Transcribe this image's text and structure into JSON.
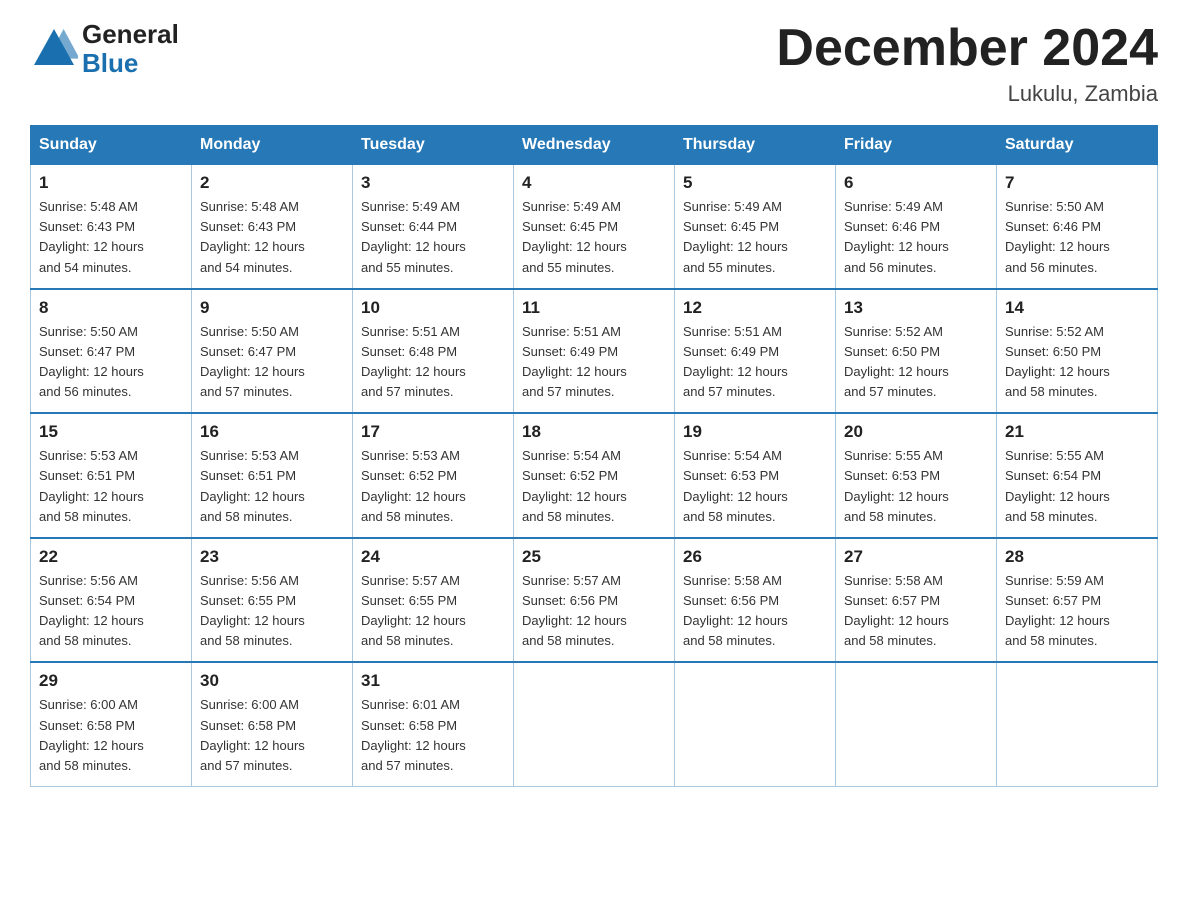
{
  "header": {
    "logo": {
      "general": "General",
      "blue": "Blue",
      "triangle_color": "#1a6faf"
    },
    "title": "December 2024",
    "location": "Lukulu, Zambia"
  },
  "calendar": {
    "days_of_week": [
      "Sunday",
      "Monday",
      "Tuesday",
      "Wednesday",
      "Thursday",
      "Friday",
      "Saturday"
    ],
    "accent_color": "#2678b6",
    "weeks": [
      [
        {
          "day": "1",
          "sunrise": "5:48 AM",
          "sunset": "6:43 PM",
          "daylight": "12 hours and 54 minutes."
        },
        {
          "day": "2",
          "sunrise": "5:48 AM",
          "sunset": "6:43 PM",
          "daylight": "12 hours and 54 minutes."
        },
        {
          "day": "3",
          "sunrise": "5:49 AM",
          "sunset": "6:44 PM",
          "daylight": "12 hours and 55 minutes."
        },
        {
          "day": "4",
          "sunrise": "5:49 AM",
          "sunset": "6:45 PM",
          "daylight": "12 hours and 55 minutes."
        },
        {
          "day": "5",
          "sunrise": "5:49 AM",
          "sunset": "6:45 PM",
          "daylight": "12 hours and 55 minutes."
        },
        {
          "day": "6",
          "sunrise": "5:49 AM",
          "sunset": "6:46 PM",
          "daylight": "12 hours and 56 minutes."
        },
        {
          "day": "7",
          "sunrise": "5:50 AM",
          "sunset": "6:46 PM",
          "daylight": "12 hours and 56 minutes."
        }
      ],
      [
        {
          "day": "8",
          "sunrise": "5:50 AM",
          "sunset": "6:47 PM",
          "daylight": "12 hours and 56 minutes."
        },
        {
          "day": "9",
          "sunrise": "5:50 AM",
          "sunset": "6:47 PM",
          "daylight": "12 hours and 57 minutes."
        },
        {
          "day": "10",
          "sunrise": "5:51 AM",
          "sunset": "6:48 PM",
          "daylight": "12 hours and 57 minutes."
        },
        {
          "day": "11",
          "sunrise": "5:51 AM",
          "sunset": "6:49 PM",
          "daylight": "12 hours and 57 minutes."
        },
        {
          "day": "12",
          "sunrise": "5:51 AM",
          "sunset": "6:49 PM",
          "daylight": "12 hours and 57 minutes."
        },
        {
          "day": "13",
          "sunrise": "5:52 AM",
          "sunset": "6:50 PM",
          "daylight": "12 hours and 57 minutes."
        },
        {
          "day": "14",
          "sunrise": "5:52 AM",
          "sunset": "6:50 PM",
          "daylight": "12 hours and 58 minutes."
        }
      ],
      [
        {
          "day": "15",
          "sunrise": "5:53 AM",
          "sunset": "6:51 PM",
          "daylight": "12 hours and 58 minutes."
        },
        {
          "day": "16",
          "sunrise": "5:53 AM",
          "sunset": "6:51 PM",
          "daylight": "12 hours and 58 minutes."
        },
        {
          "day": "17",
          "sunrise": "5:53 AM",
          "sunset": "6:52 PM",
          "daylight": "12 hours and 58 minutes."
        },
        {
          "day": "18",
          "sunrise": "5:54 AM",
          "sunset": "6:52 PM",
          "daylight": "12 hours and 58 minutes."
        },
        {
          "day": "19",
          "sunrise": "5:54 AM",
          "sunset": "6:53 PM",
          "daylight": "12 hours and 58 minutes."
        },
        {
          "day": "20",
          "sunrise": "5:55 AM",
          "sunset": "6:53 PM",
          "daylight": "12 hours and 58 minutes."
        },
        {
          "day": "21",
          "sunrise": "5:55 AM",
          "sunset": "6:54 PM",
          "daylight": "12 hours and 58 minutes."
        }
      ],
      [
        {
          "day": "22",
          "sunrise": "5:56 AM",
          "sunset": "6:54 PM",
          "daylight": "12 hours and 58 minutes."
        },
        {
          "day": "23",
          "sunrise": "5:56 AM",
          "sunset": "6:55 PM",
          "daylight": "12 hours and 58 minutes."
        },
        {
          "day": "24",
          "sunrise": "5:57 AM",
          "sunset": "6:55 PM",
          "daylight": "12 hours and 58 minutes."
        },
        {
          "day": "25",
          "sunrise": "5:57 AM",
          "sunset": "6:56 PM",
          "daylight": "12 hours and 58 minutes."
        },
        {
          "day": "26",
          "sunrise": "5:58 AM",
          "sunset": "6:56 PM",
          "daylight": "12 hours and 58 minutes."
        },
        {
          "day": "27",
          "sunrise": "5:58 AM",
          "sunset": "6:57 PM",
          "daylight": "12 hours and 58 minutes."
        },
        {
          "day": "28",
          "sunrise": "5:59 AM",
          "sunset": "6:57 PM",
          "daylight": "12 hours and 58 minutes."
        }
      ],
      [
        {
          "day": "29",
          "sunrise": "6:00 AM",
          "sunset": "6:58 PM",
          "daylight": "12 hours and 58 minutes."
        },
        {
          "day": "30",
          "sunrise": "6:00 AM",
          "sunset": "6:58 PM",
          "daylight": "12 hours and 57 minutes."
        },
        {
          "day": "31",
          "sunrise": "6:01 AM",
          "sunset": "6:58 PM",
          "daylight": "12 hours and 57 minutes."
        },
        null,
        null,
        null,
        null
      ]
    ],
    "sunrise_label": "Sunrise:",
    "sunset_label": "Sunset:",
    "daylight_label": "Daylight:"
  }
}
